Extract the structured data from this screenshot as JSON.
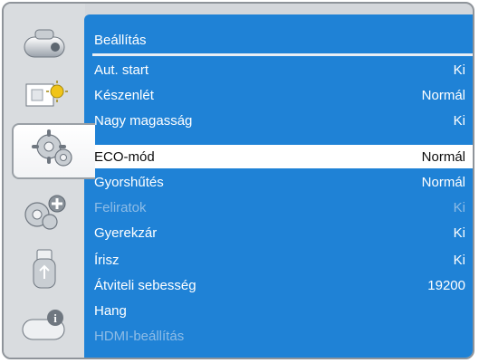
{
  "panel": {
    "title": "Beállítás"
  },
  "rows": [
    {
      "label": "Aut. start",
      "value": "Ki"
    },
    {
      "label": "Készenlét",
      "value": "Normál"
    },
    {
      "label": "Nagy magasság",
      "value": "Ki"
    },
    {
      "label": "ECO-mód",
      "value": "Normál"
    },
    {
      "label": "Gyorshűtés",
      "value": "Normál"
    },
    {
      "label": "Feliratok",
      "value": "Ki"
    },
    {
      "label": "Gyerekzár",
      "value": "Ki"
    },
    {
      "label": "Írisz",
      "value": "Ki"
    },
    {
      "label": "Átviteli sebesség",
      "value": "19200"
    },
    {
      "label": "Hang",
      "value": ""
    },
    {
      "label": "HDMI-beállítás",
      "value": ""
    }
  ],
  "sidebar": {
    "icons": [
      "projector-icon",
      "picture-settings-icon",
      "gear-settings-icon",
      "advanced-gear-plus-icon",
      "usb-icon",
      "info-icon"
    ],
    "active_index": 2
  },
  "colors": {
    "panel_bg": "#1f82d6",
    "selected_bg": "#ffffff",
    "disabled_text": "#8ebce6",
    "sidebar_bg": "#d9dcdf"
  }
}
